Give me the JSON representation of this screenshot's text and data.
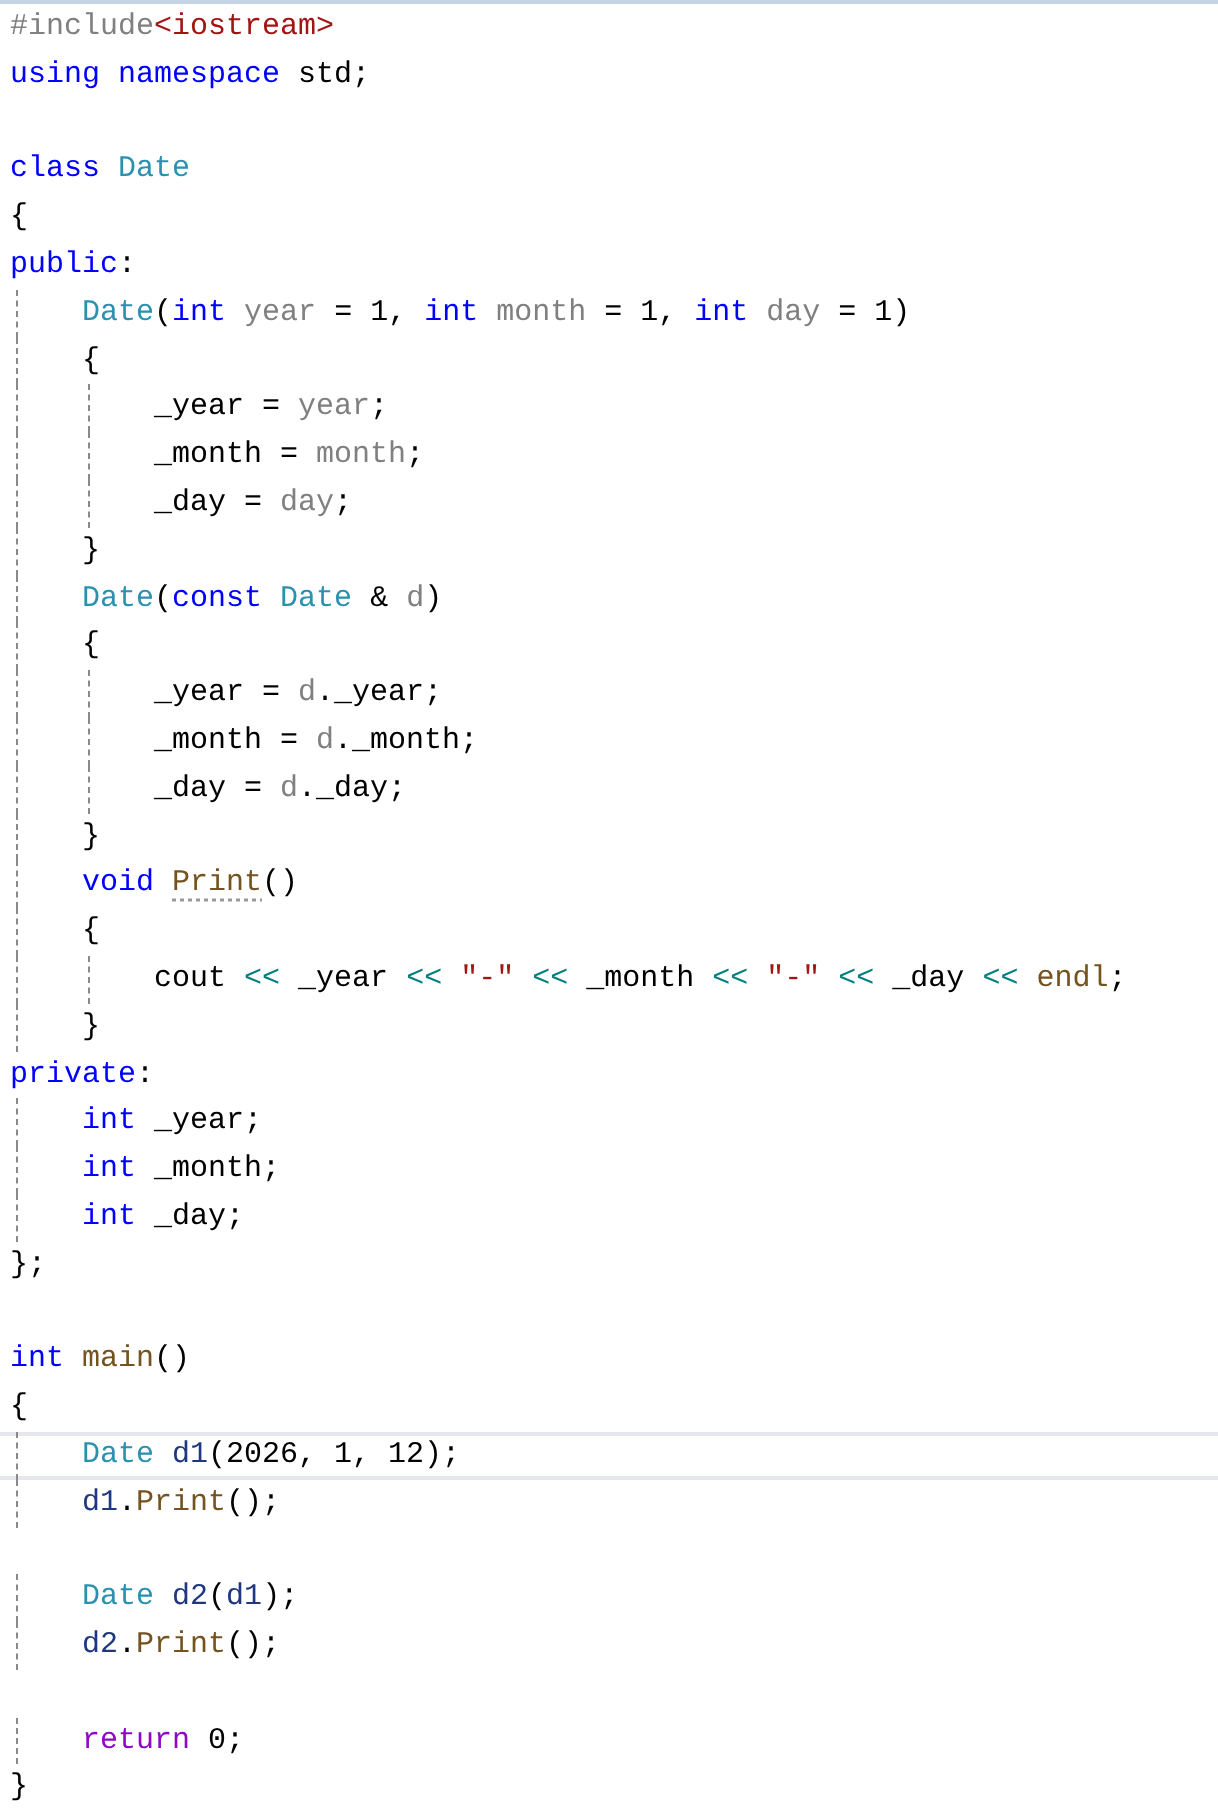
{
  "editor": {
    "lines": [
      {
        "current": false,
        "tokens": [
          {
            "kind": "preproc",
            "text": "#include"
          },
          {
            "kind": "include-path",
            "text": "<iostream>"
          }
        ]
      },
      {
        "current": false,
        "tokens": [
          {
            "kind": "keyword",
            "text": "using"
          },
          {
            "kind": "keyword",
            "text": " namespace"
          },
          {
            "kind": "plain",
            "text": " std;"
          }
        ]
      },
      {
        "current": false
      },
      {
        "current": false,
        "tokens": [
          {
            "kind": "keyword",
            "text": "class"
          },
          {
            "kind": "type",
            "text": " Date"
          }
        ]
      },
      {
        "current": false,
        "tokens": [
          {
            "kind": "plain",
            "text": "{"
          }
        ]
      },
      {
        "current": false,
        "tokens": [
          {
            "kind": "keyword",
            "text": "public"
          },
          {
            "kind": "plain",
            "text": ":"
          }
        ]
      },
      {
        "current": false,
        "tokens": [
          {
            "kind": "type",
            "text": "    Date"
          },
          {
            "kind": "plain",
            "text": "("
          },
          {
            "kind": "keyword",
            "text": "int"
          },
          {
            "kind": "param",
            "text": " year"
          },
          {
            "kind": "plain",
            "text": " = 1, "
          },
          {
            "kind": "keyword",
            "text": "int"
          },
          {
            "kind": "param",
            "text": " month"
          },
          {
            "kind": "plain",
            "text": " = 1, "
          },
          {
            "kind": "keyword",
            "text": "int"
          },
          {
            "kind": "param",
            "text": " day"
          },
          {
            "kind": "plain",
            "text": " = 1)"
          }
        ]
      },
      {
        "current": false,
        "tokens": [
          {
            "kind": "plain",
            "text": "    {"
          }
        ]
      },
      {
        "current": false,
        "tokens": [
          {
            "kind": "plain",
            "text": "        _year = "
          },
          {
            "kind": "param",
            "text": "year"
          },
          {
            "kind": "plain",
            "text": ";"
          }
        ]
      },
      {
        "current": false,
        "tokens": [
          {
            "kind": "plain",
            "text": "        _month = "
          },
          {
            "kind": "param",
            "text": "month"
          },
          {
            "kind": "plain",
            "text": ";"
          }
        ]
      },
      {
        "current": false,
        "tokens": [
          {
            "kind": "plain",
            "text": "        _day = "
          },
          {
            "kind": "param",
            "text": "day"
          },
          {
            "kind": "plain",
            "text": ";"
          }
        ]
      },
      {
        "current": false,
        "tokens": [
          {
            "kind": "plain",
            "text": "    }"
          }
        ]
      },
      {
        "current": false,
        "tokens": [
          {
            "kind": "type",
            "text": "    Date"
          },
          {
            "kind": "plain",
            "text": "("
          },
          {
            "kind": "keyword",
            "text": "const"
          },
          {
            "kind": "type",
            "text": " Date"
          },
          {
            "kind": "plain",
            "text": " & "
          },
          {
            "kind": "param",
            "text": "d"
          },
          {
            "kind": "plain",
            "text": ")"
          }
        ]
      },
      {
        "current": false,
        "tokens": [
          {
            "kind": "plain",
            "text": "    {"
          }
        ]
      },
      {
        "current": false,
        "tokens": [
          {
            "kind": "plain",
            "text": "        _year = "
          },
          {
            "kind": "param",
            "text": "d"
          },
          {
            "kind": "plain",
            "text": "._year;"
          }
        ]
      },
      {
        "current": false,
        "tokens": [
          {
            "kind": "plain",
            "text": "        _month = "
          },
          {
            "kind": "param",
            "text": "d"
          },
          {
            "kind": "plain",
            "text": "._month;"
          }
        ]
      },
      {
        "current": false,
        "tokens": [
          {
            "kind": "plain",
            "text": "        _day = "
          },
          {
            "kind": "param",
            "text": "d"
          },
          {
            "kind": "plain",
            "text": "._day;"
          }
        ]
      },
      {
        "current": false,
        "tokens": [
          {
            "kind": "plain",
            "text": "    }"
          }
        ]
      },
      {
        "current": false,
        "tokens": [
          {
            "kind": "keyword",
            "text": "    void "
          },
          {
            "kind": "function-hint",
            "text": "Print"
          },
          {
            "kind": "plain",
            "text": "()"
          }
        ]
      },
      {
        "current": false,
        "tokens": [
          {
            "kind": "plain",
            "text": "    {"
          }
        ]
      },
      {
        "current": false,
        "tokens": [
          {
            "kind": "plain",
            "text": "        cout "
          },
          {
            "kind": "operator",
            "text": "<<"
          },
          {
            "kind": "plain",
            "text": " _year "
          },
          {
            "kind": "operator",
            "text": "<<"
          },
          {
            "kind": "string",
            "text": " \"-\""
          },
          {
            "kind": "operator",
            "text": " <<"
          },
          {
            "kind": "plain",
            "text": " _month "
          },
          {
            "kind": "operator",
            "text": "<<"
          },
          {
            "kind": "string",
            "text": " \"-\""
          },
          {
            "kind": "operator",
            "text": " <<"
          },
          {
            "kind": "plain",
            "text": " _day "
          },
          {
            "kind": "operator",
            "text": "<<"
          },
          {
            "kind": "function",
            "text": " endl"
          },
          {
            "kind": "plain",
            "text": ";"
          }
        ]
      },
      {
        "current": false,
        "tokens": [
          {
            "kind": "plain",
            "text": "    }"
          }
        ]
      },
      {
        "current": false,
        "tokens": [
          {
            "kind": "keyword",
            "text": "private"
          },
          {
            "kind": "plain",
            "text": ":"
          }
        ]
      },
      {
        "current": false,
        "tokens": [
          {
            "kind": "keyword",
            "text": "    int"
          },
          {
            "kind": "plain",
            "text": " _year;"
          }
        ]
      },
      {
        "current": false,
        "tokens": [
          {
            "kind": "keyword",
            "text": "    int"
          },
          {
            "kind": "plain",
            "text": " _month;"
          }
        ]
      },
      {
        "current": false,
        "tokens": [
          {
            "kind": "keyword",
            "text": "    int"
          },
          {
            "kind": "plain",
            "text": " _day;"
          }
        ]
      },
      {
        "current": false,
        "tokens": [
          {
            "kind": "plain",
            "text": "};"
          }
        ]
      },
      {
        "current": false
      },
      {
        "current": false,
        "tokens": [
          {
            "kind": "keyword",
            "text": "int"
          },
          {
            "kind": "function",
            "text": " main"
          },
          {
            "kind": "plain",
            "text": "()"
          }
        ]
      },
      {
        "current": false,
        "tokens": [
          {
            "kind": "plain",
            "text": "{"
          }
        ]
      },
      {
        "current": true,
        "tokens": [
          {
            "kind": "type",
            "text": "    Date"
          },
          {
            "kind": "local",
            "text": " d1"
          },
          {
            "kind": "plain",
            "text": "(2026, 1, 12);"
          }
        ]
      },
      {
        "current": false,
        "tokens": [
          {
            "kind": "local",
            "text": "    d1"
          },
          {
            "kind": "plain",
            "text": "."
          },
          {
            "kind": "function",
            "text": "Print"
          },
          {
            "kind": "plain",
            "text": "();"
          }
        ]
      },
      {
        "current": false
      },
      {
        "current": false,
        "tokens": [
          {
            "kind": "type",
            "text": "    Date"
          },
          {
            "kind": "local",
            "text": " d2"
          },
          {
            "kind": "plain",
            "text": "("
          },
          {
            "kind": "local",
            "text": "d1"
          },
          {
            "kind": "plain",
            "text": ");"
          }
        ]
      },
      {
        "current": false,
        "tokens": [
          {
            "kind": "local",
            "text": "    d2"
          },
          {
            "kind": "plain",
            "text": "."
          },
          {
            "kind": "function",
            "text": "Print"
          },
          {
            "kind": "plain",
            "text": "();"
          }
        ]
      },
      {
        "current": false
      },
      {
        "current": false,
        "tokens": [
          {
            "kind": "control",
            "text": "    return"
          },
          {
            "kind": "plain",
            "text": " 0;"
          }
        ]
      },
      {
        "current": false,
        "tokens": [
          {
            "kind": "plain",
            "text": "}"
          }
        ]
      }
    ]
  }
}
